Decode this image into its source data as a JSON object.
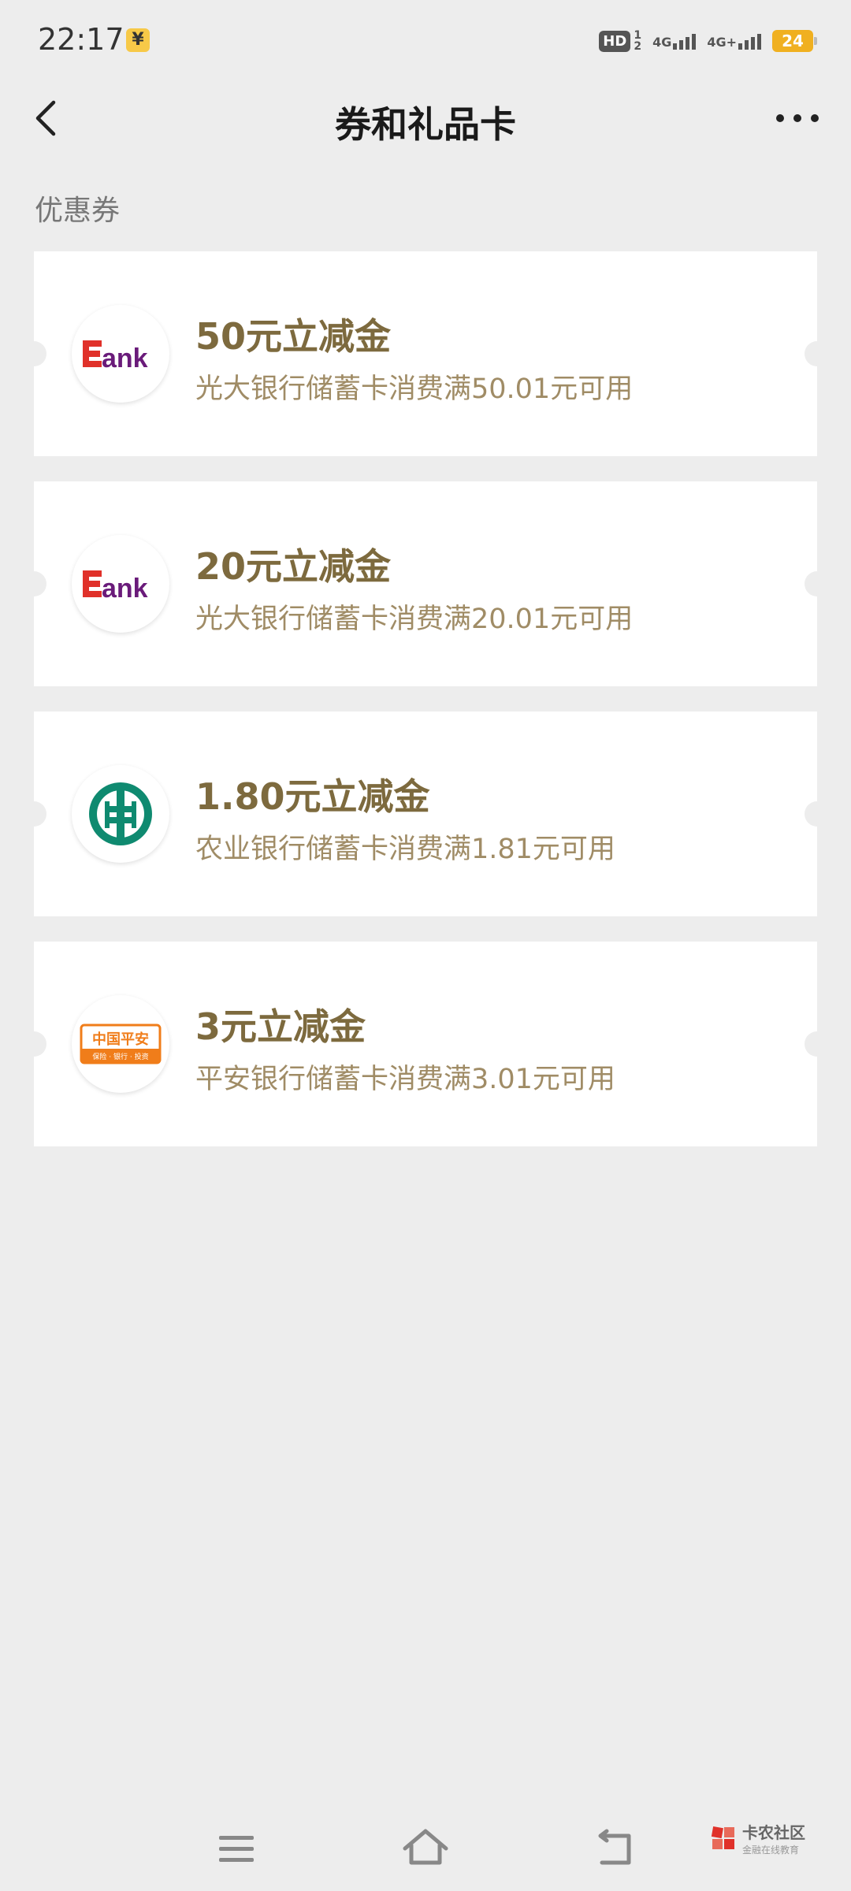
{
  "status_bar": {
    "time": "22:17",
    "yuan_badge": "¥",
    "hd": "HD",
    "hd_num_top": "1",
    "hd_num_bottom": "2",
    "net1": "4G",
    "net2": "4G+",
    "battery": "24"
  },
  "nav": {
    "title": "券和礼品卡"
  },
  "section": {
    "label": "优惠券"
  },
  "coupons": [
    {
      "title": "50元立减金",
      "desc": "光大银行储蓄卡消费满50.01元可用",
      "logo_text": "Bank",
      "logo_icon": "ceb-bank-logo"
    },
    {
      "title": "20元立减金",
      "desc": "光大银行储蓄卡消费满20.01元可用",
      "logo_text": "Bank",
      "logo_icon": "ceb-bank-logo"
    },
    {
      "title": "1.80元立减金",
      "desc": "农业银行储蓄卡消费满1.81元可用",
      "logo_icon": "abc-bank-logo"
    },
    {
      "title": "3元立减金",
      "desc": "平安银行储蓄卡消费满3.01元可用",
      "logo_text": "中国平安",
      "logo_sub": "保险 · 银行 · 投资",
      "logo_icon": "pingan-bank-logo"
    }
  ],
  "watermark": {
    "main": "卡农社区",
    "sub": "金融在线教育"
  },
  "colors": {
    "background": "#ededed",
    "coupon_title": "#7d6a3e",
    "coupon_desc": "#a08c66",
    "ceb_red": "#e0312a",
    "ceb_purple": "#6a1b7a",
    "abc_green": "#0f8a70",
    "pingan_orange": "#f07d1a"
  }
}
